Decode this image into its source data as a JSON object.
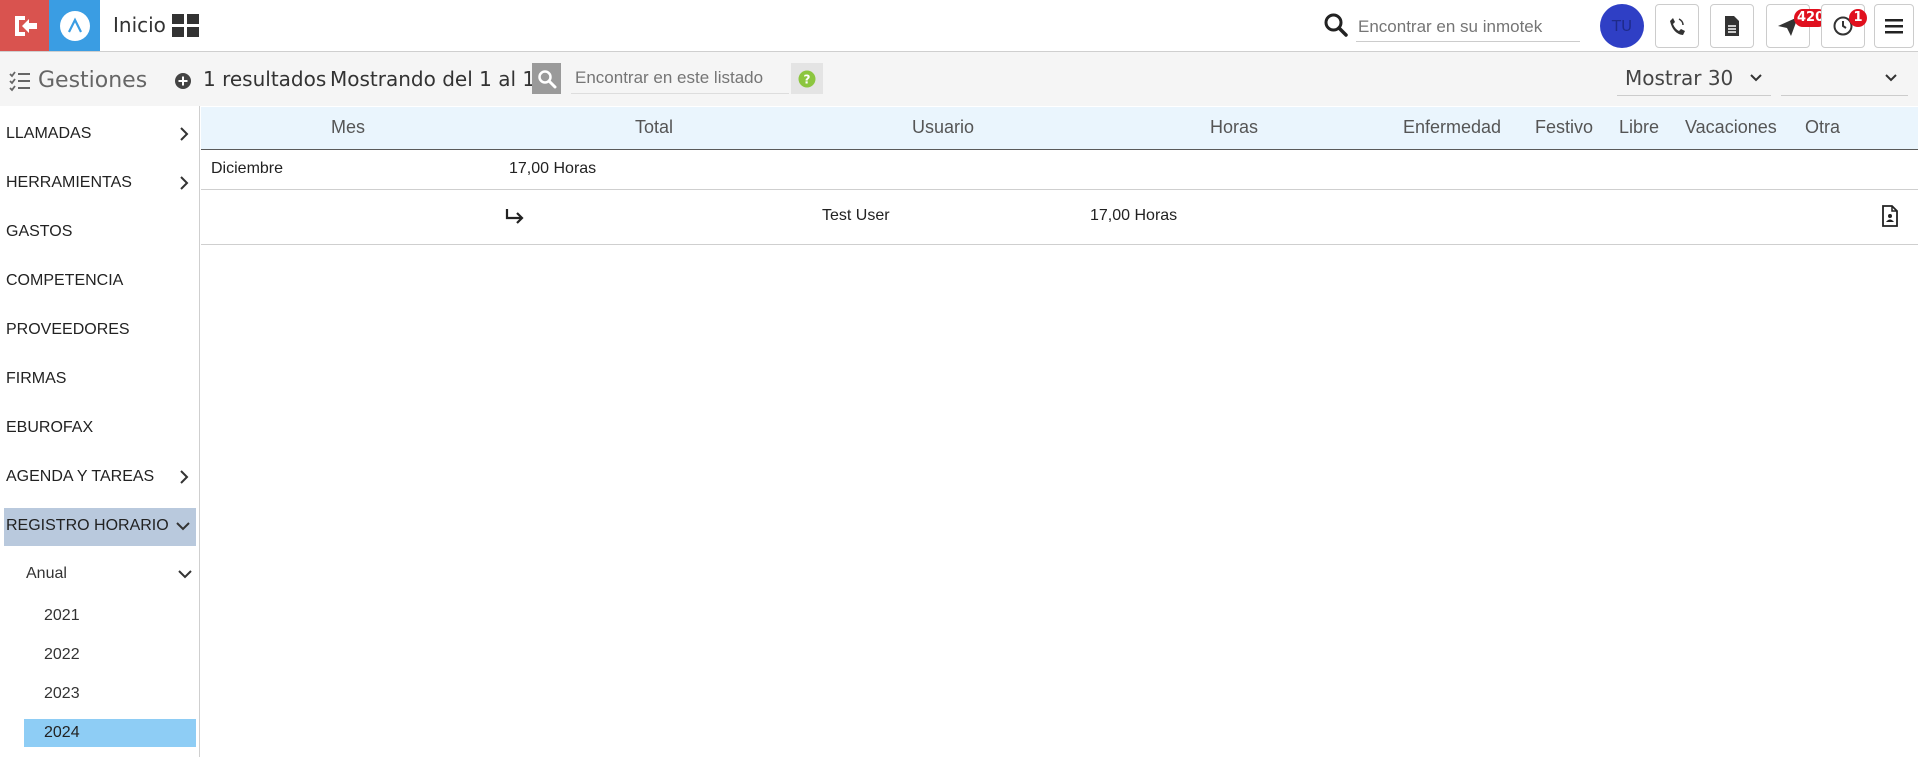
{
  "topbar": {
    "home_label": "Inicio",
    "search_placeholder": "Encontrar en su inmotek",
    "avatar_initials": "TU",
    "messages_badge": "420",
    "alerts_badge": "1"
  },
  "toolbar": {
    "title": "Gestiones",
    "results": "1 resultados",
    "range": "Mostrando del 1 al 1",
    "list_search_placeholder": "Encontrar en este listado",
    "show_select": "Mostrar 30"
  },
  "sidebar": {
    "items": [
      {
        "label": "LLAMADAS"
      },
      {
        "label": "HERRAMIENTAS"
      },
      {
        "label": "GASTOS"
      },
      {
        "label": "COMPETENCIA"
      },
      {
        "label": "PROVEEDORES"
      },
      {
        "label": "FIRMAS"
      },
      {
        "label": "EBUROFAX"
      },
      {
        "label": "AGENDA Y TAREAS"
      },
      {
        "label": "REGISTRO HORARIO"
      }
    ],
    "sub_label": "Anual",
    "years": [
      "2021",
      "2022",
      "2023",
      "2024"
    ]
  },
  "table": {
    "headers": [
      "Mes",
      "Total",
      "Usuario",
      "Horas",
      "Enfermedad",
      "Festivo",
      "Libre",
      "Vacaciones",
      "Otra"
    ],
    "month_row": {
      "month": "Diciembre",
      "total": "17,00 Horas"
    },
    "user_row": {
      "user": "Test User",
      "hours": "17,00 Horas"
    }
  },
  "colors": {
    "exit": "#d9534f",
    "app": "#3a9de3",
    "avatar": "#2f3fc5",
    "badge": "#e0101e",
    "active_menu": "#b9c9dd",
    "active_year": "#8ecdf5",
    "header_bg": "#eaf5fd"
  }
}
